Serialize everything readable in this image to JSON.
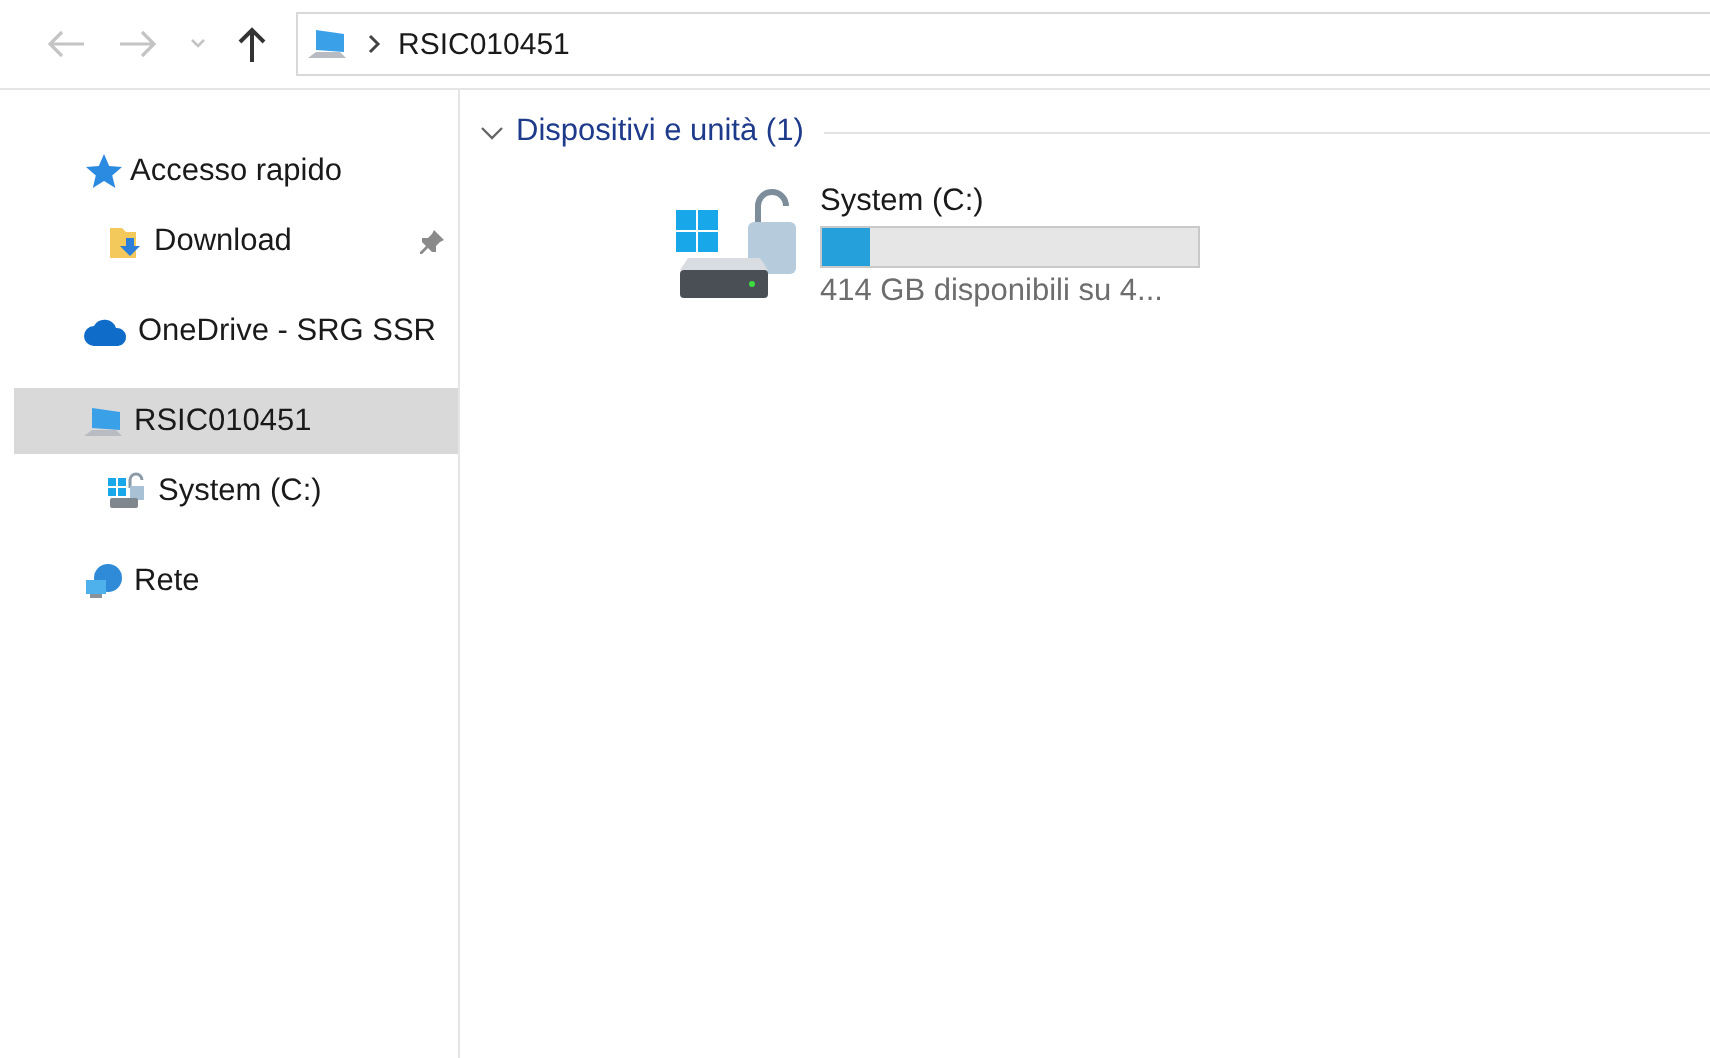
{
  "toolbar": {
    "buttons": [
      {
        "kind": "back",
        "disabled": true
      },
      {
        "kind": "forward",
        "disabled": true
      },
      {
        "kind": "recent",
        "disabled": true
      },
      {
        "kind": "up",
        "disabled": false
      }
    ],
    "address": {
      "path": "RSIC010451"
    }
  },
  "sidebar": {
    "items": [
      {
        "label": "Accesso rapido",
        "kind": "quick",
        "selected": false,
        "children": [
          {
            "label": "Download",
            "kind": "download",
            "selected": false,
            "pinned": true
          }
        ]
      },
      {
        "label": "OneDrive - SRG SSR",
        "kind": "cloud",
        "selected": false
      },
      {
        "label": "RSIC010451",
        "kind": "pc",
        "selected": true,
        "children": [
          {
            "label": "System (C:)",
            "kind": "drive",
            "selected": false
          }
        ]
      },
      {
        "label": "Rete",
        "kind": "network",
        "selected": false
      }
    ]
  },
  "groups": [
    {
      "title": "Dispositivi e unità (1)",
      "expanded": true,
      "drives": [
        {
          "name": "System (C:)",
          "level": 0.13,
          "info": "414 GB disponibili su 4..."
        }
      ]
    }
  ]
}
